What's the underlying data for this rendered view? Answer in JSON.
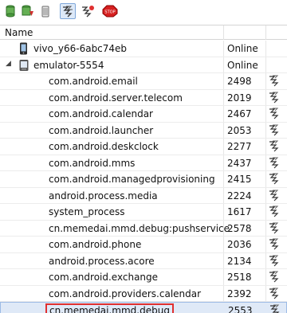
{
  "toolbar": {
    "buttons": [
      {
        "name": "update-heap-icon"
      },
      {
        "name": "dump-hprof-icon"
      },
      {
        "name": "cause-gc-icon"
      },
      {
        "name": "debug-process-icon"
      },
      {
        "name": "update-threads-icon"
      },
      {
        "name": "stop-process-icon"
      }
    ],
    "stop_text": "STOP"
  },
  "table": {
    "header_name": "Name",
    "devices": [
      {
        "name": "vivo_y66-6abc74eb",
        "status": "Online",
        "expanded": false
      },
      {
        "name": "emulator-5554",
        "status": "Online",
        "expanded": true
      }
    ],
    "processes": [
      {
        "name": "com.android.email",
        "pid": "2498"
      },
      {
        "name": "com.android.server.telecom",
        "pid": "2019"
      },
      {
        "name": "com.android.calendar",
        "pid": "2467"
      },
      {
        "name": "com.android.launcher",
        "pid": "2053"
      },
      {
        "name": "com.android.deskclock",
        "pid": "2277"
      },
      {
        "name": "com.android.mms",
        "pid": "2437"
      },
      {
        "name": "com.android.managedprovisioning",
        "pid": "2415"
      },
      {
        "name": "android.process.media",
        "pid": "2224"
      },
      {
        "name": "system_process",
        "pid": "1617"
      },
      {
        "name": "cn.memedai.mmd.debug:pushservice",
        "pid": "2578"
      },
      {
        "name": "com.android.phone",
        "pid": "2036"
      },
      {
        "name": "android.process.acore",
        "pid": "2134"
      },
      {
        "name": "com.android.exchange",
        "pid": "2518"
      },
      {
        "name": "com.android.providers.calendar",
        "pid": "2392"
      },
      {
        "name": "cn.memedai.mmd.debug",
        "pid": "2553"
      }
    ]
  }
}
